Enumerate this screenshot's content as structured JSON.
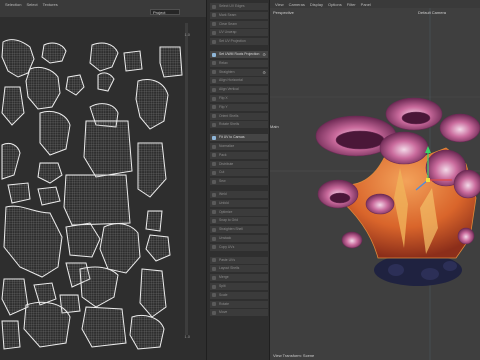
{
  "uv_editor": {
    "menu": [
      "Selection",
      "Select",
      "Textures"
    ],
    "project_select": "Project",
    "scale_top": "1.0",
    "scale_bottom": "1.0"
  },
  "tools": [
    {
      "label": "Select UV Edges"
    },
    {
      "label": "Mark Seam",
      "icon": "seam-icon"
    },
    {
      "label": "Clear Seam"
    },
    {
      "label": "UV Unwrap",
      "icon": "unwrap-icon"
    },
    {
      "label": "Set UV Projection"
    },
    {
      "label": "Set UWM Roots Projection",
      "active": true,
      "gear": true
    },
    {
      "label": "Relax",
      "icon": "relax-icon"
    },
    {
      "label": "Straighten",
      "gear": true
    },
    {
      "label": "Align Horizontal"
    },
    {
      "label": "Align Vertical"
    },
    {
      "label": "Flip X"
    },
    {
      "label": "Flip Y"
    },
    {
      "label": "Orient Shells"
    },
    {
      "label": "Rotate Shells"
    },
    {
      "label": "Fit UV to Canvas",
      "active": true
    },
    {
      "label": "Normalize"
    },
    {
      "label": "Pack"
    },
    {
      "label": "Distribute"
    },
    {
      "label": "Cut"
    },
    {
      "label": "Sew"
    },
    {
      "label": "Weld"
    },
    {
      "label": "Unfold"
    },
    {
      "label": "Optimize"
    },
    {
      "label": "Snap to Grid"
    },
    {
      "label": "Straighten Shell"
    },
    {
      "label": "Unstack"
    },
    {
      "label": "Copy UVs"
    },
    {
      "label": "Paste UVs"
    },
    {
      "label": "Layout Shells"
    },
    {
      "label": "Merge"
    },
    {
      "label": "Split"
    },
    {
      "label": "Scale"
    },
    {
      "label": "Rotate"
    },
    {
      "label": "Move"
    }
  ],
  "viewport": {
    "menu": [
      "View",
      "Cameras",
      "Display",
      "Options",
      "Filter",
      "Panel"
    ],
    "perspective_label": "Perspective",
    "camera_label": "Default Camera",
    "world_label": "Main",
    "status": "View Transform: Scene"
  },
  "colors": {
    "panel_bg": "#2e2e2e",
    "viewport_bg": "#3f3f3f",
    "uv_wire": "#e6e6e6",
    "petal_purple": "#7a2f5c",
    "body_orange": "#d9652b",
    "base_navy": "#1f2240"
  }
}
